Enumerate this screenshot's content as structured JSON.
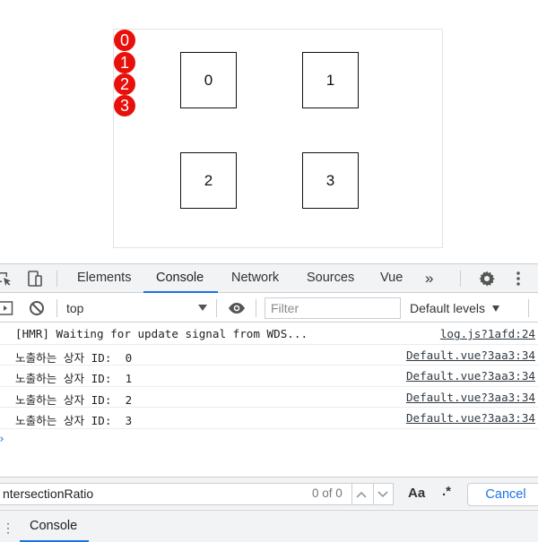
{
  "viewport": {
    "badges": [
      "0",
      "1",
      "2",
      "3"
    ],
    "boxes": [
      "0",
      "1",
      "2",
      "3"
    ]
  },
  "devtools": {
    "tabs": [
      {
        "label": "Elements",
        "active": false
      },
      {
        "label": "Console",
        "active": true
      },
      {
        "label": "Network",
        "active": false
      },
      {
        "label": "Sources",
        "active": false
      },
      {
        "label": "Vue",
        "active": false
      }
    ],
    "more_tabs": "»",
    "toolbar": {
      "context": "top",
      "filter_placeholder": "Filter",
      "levels": "Default levels"
    },
    "console_rows": [
      {
        "message": "[HMR] Waiting for update signal from WDS...",
        "source": "log.js?1afd:24"
      },
      {
        "message": "노출하는 상자 ID:  0",
        "source": "Default.vue?3aa3:34"
      },
      {
        "message": "노출하는 상자 ID:  1",
        "source": "Default.vue?3aa3:34"
      },
      {
        "message": "노출하는 상자 ID:  2",
        "source": "Default.vue?3aa3:34"
      },
      {
        "message": "노출하는 상자 ID:  3",
        "source": "Default.vue?3aa3:34"
      }
    ],
    "prompt": "›",
    "search": {
      "value": "ntersectionRatio",
      "match_count": "0 of 0",
      "case_label": "Aa",
      "regex_label": ".*",
      "cancel_label": "Cancel"
    },
    "drawer": {
      "menu": "⋮",
      "tab": "Console"
    }
  },
  "colors": {
    "badge": "#e8100b",
    "accent": "#1a73e8"
  }
}
